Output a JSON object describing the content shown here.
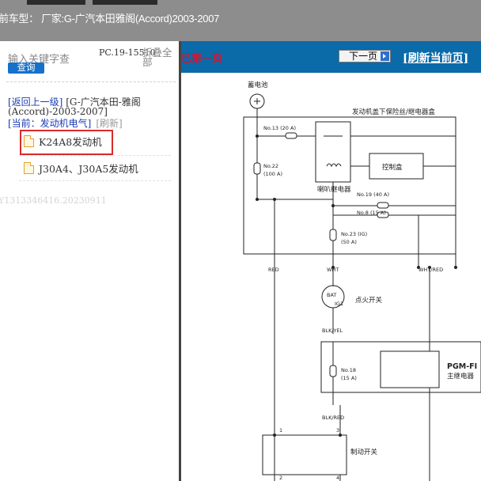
{
  "header": {
    "title": "前车型： 厂家:G-广汽本田雅阁(Accord)2003-2007"
  },
  "sidebar": {
    "search_label": "输入关键字查",
    "search_button": "查询",
    "pc_code": "PC.19-15510",
    "fold_all": "折叠全部",
    "back_link": "[返回上一级]",
    "back_path": "[G-广汽本田-雅阁(Accord)-2003-2007]",
    "current_label": "[当前：发动机电气]",
    "refresh_label": "[刷新]",
    "items": [
      {
        "label": "K24A8发动机",
        "selected": true
      },
      {
        "label": "J30A4、J30A5发动机",
        "selected": false
      }
    ],
    "watermark": "Y1313346416.20230911"
  },
  "viewer": {
    "first_page_notice": "已第一页",
    "next_page_label": "下一页",
    "refresh_page_label": "[刷新当前页]"
  },
  "diagram": {
    "battery": "蓄电池",
    "fuse_box": "发动机盖下保险丝/继电器盒",
    "fuse_13": "No.13 (20 A)",
    "fuse_22a": "No.22",
    "fuse_22b": "(100 A)",
    "horn_relay": "喇叭继电器",
    "control_box": "控制盒",
    "fuse_19": "No.19 (40 A)",
    "fuse_8": "No.8 (15 A)",
    "fuse_23a": "No.23 (IG)",
    "fuse_23b": "(50 A)",
    "wire_red": "RED",
    "wire_wht": "WHT",
    "wire_whtred": "WHT/RED",
    "bat": "BAT",
    "ig1": "IG1",
    "ignition_switch": "点火开关",
    "wire_blkyel": "BLK/YEL",
    "fuse_18a": "No.18",
    "fuse_18b": "(15 A)",
    "pgm_fi": "PGM-FI",
    "main_relay": "主继电器",
    "wire_blkred": "BLK/RED",
    "pin_1": "1",
    "pin_3": "3",
    "pin_2": "2",
    "pin_4": "4",
    "brake_switch": "制动开关"
  },
  "colors": {
    "accent_blue": "#0b6aa8",
    "highlight_red": "#d92b2b",
    "notice_red": "#e0102a"
  }
}
